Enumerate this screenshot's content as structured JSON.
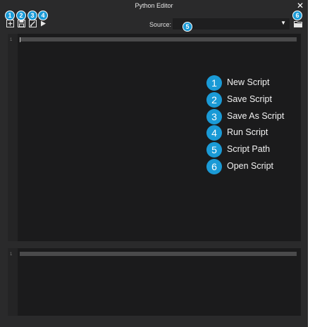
{
  "window": {
    "title": "Python Editor",
    "close_glyph": "✕"
  },
  "toolbar": {
    "buttons": [
      {
        "name": "new-script-button",
        "icon": "new-script-icon"
      },
      {
        "name": "save-script-button",
        "icon": "save-icon"
      },
      {
        "name": "save-as-script-button",
        "icon": "save-as-icon"
      },
      {
        "name": "run-script-button",
        "icon": "play-icon"
      }
    ],
    "source_label": "Source:",
    "source_value": "",
    "open_button_icon": "folder-open-icon"
  },
  "editor": {
    "line_number": "1"
  },
  "console": {
    "line_number": "1"
  },
  "badges": [
    "1",
    "2",
    "3",
    "4",
    "5",
    "6"
  ],
  "legend": [
    {
      "num": "1",
      "label": "New Script"
    },
    {
      "num": "2",
      "label": "Save Script"
    },
    {
      "num": "3",
      "label": "Save As Script"
    },
    {
      "num": "4",
      "label": "Run Script"
    },
    {
      "num": "5",
      "label": "Script Path"
    },
    {
      "num": "6",
      "label": "Open Script"
    }
  ],
  "colors": {
    "accent": "#1a9ad6",
    "window_bg": "#2a2a2b",
    "editor_bg": "#1b1b1c"
  }
}
